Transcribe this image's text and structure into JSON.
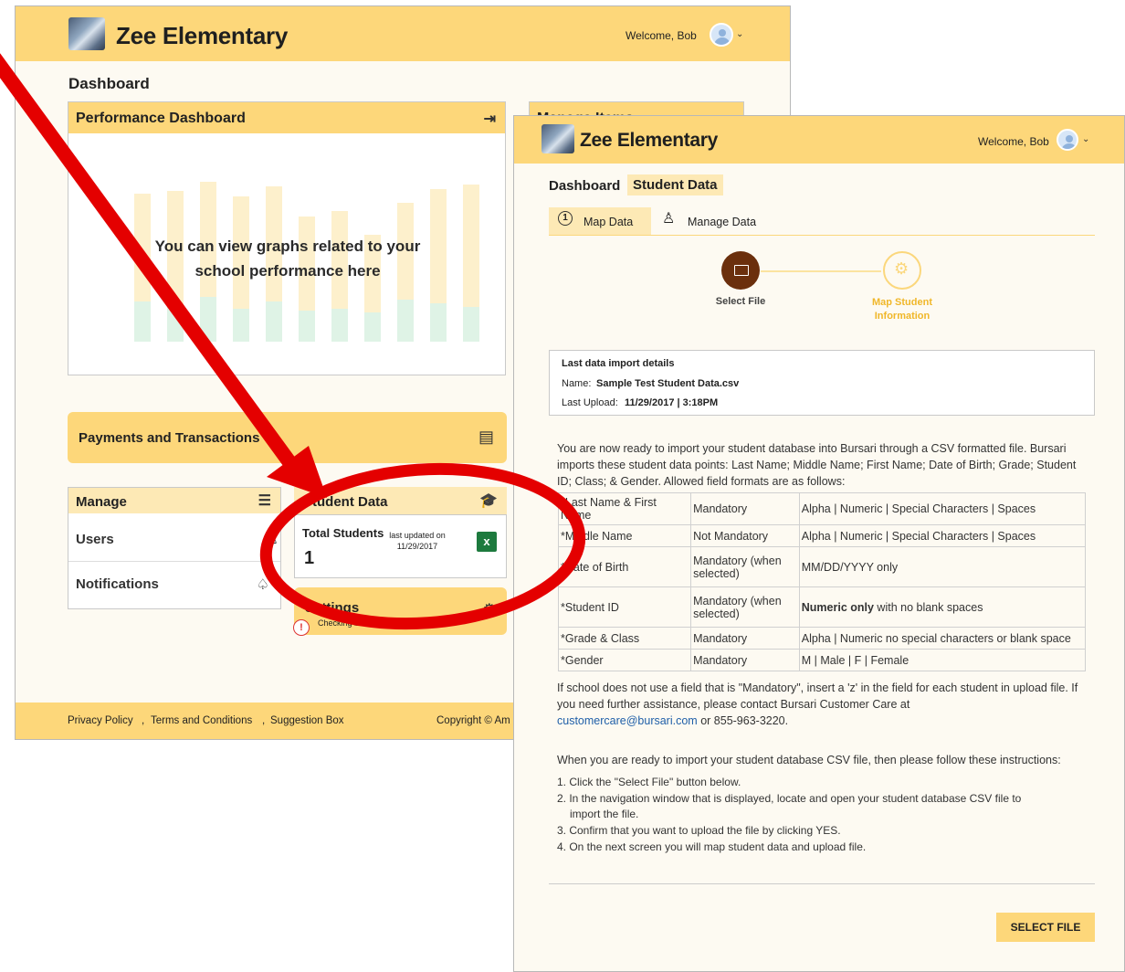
{
  "app": {
    "brand": "Zee Elementary",
    "welcome": "Welcome, Bob"
  },
  "dash": {
    "title": "Dashboard",
    "performance": {
      "title": "Performance Dashboard",
      "overlay": "You can view graphs related to your school performance here"
    },
    "manage_items_title": "Manage Items",
    "payments": "Payments and Transactions",
    "manage": {
      "title": "Manage",
      "items": [
        "Users",
        "Notifications"
      ]
    },
    "student_data": {
      "title": "Student Data",
      "total_label": "Total Students",
      "updated": "last updated on 11/29/2017",
      "count": "1"
    },
    "settings": {
      "title": "Settings",
      "status": "Checking bank"
    },
    "footer": {
      "privacy": "Privacy Policy",
      "terms": "Terms and Conditions",
      "suggestion": "Suggestion Box",
      "copyright": "Copyright © Am"
    }
  },
  "student_win": {
    "breadcrumb": {
      "dashboard": "Dashboard",
      "current": "Student Data"
    },
    "tabs": [
      "Map Data",
      "Manage Data"
    ],
    "steps": [
      "Select File",
      "Map Student Information"
    ],
    "last_import": {
      "heading": "Last data import details",
      "name_label": "Name:",
      "name_value": "Sample Test Student Data.csv",
      "upload_label": "Last Upload:",
      "upload_value": "11/29/2017 | 3:18PM"
    },
    "intro": "You are now ready to import your student database into Bursari through a CSV formatted file. Bursari imports these student data points: Last Name; Middle Name; First Name; Date of Birth; Grade; Student ID; Class; & Gender. Allowed field formats are as follows:",
    "table": [
      [
        "*Last Name & First Name",
        "Mandatory",
        "Alpha | Numeric | Special Characters | Spaces"
      ],
      [
        "*Middle Name",
        "Not Mandatory",
        "Alpha | Numeric | Special Characters | Spaces"
      ],
      [
        "*Date of Birth",
        "Mandatory (when selected)",
        "MM/DD/YYYY only"
      ],
      [
        "*Student ID",
        "Mandatory (when selected)",
        "with no blank spaces"
      ],
      [
        "*Grade & Class",
        "Mandatory",
        "Alpha | Numeric no special characters or blank space"
      ],
      [
        "*Gender",
        "Mandatory",
        "M | Male | F | Female"
      ]
    ],
    "table_bold": "Numeric only",
    "help_text": "If school does not use a field that is \"Mandatory\", insert a 'z' in the field for each student in upload file. If you need further assistance, please contact Bursari Customer Care at",
    "help_email": "customercare@bursari.com",
    "help_phone": "or 855-963-3220.",
    "instructions_intro": "When you are ready to import your student database CSV file, then please follow these instructions:",
    "instructions": [
      "1.  Click the \"Select File\" button below.",
      "2.  In the navigation window that is displayed, locate and open your student database CSV file to",
      "import the file.",
      "3.  Confirm that you want to upload the file by clicking YES.",
      "4.  On the next screen you will map student data and upload file."
    ],
    "select_button": "SELECT FILE"
  },
  "colors": {
    "header": "#fdd77a",
    "accent_brown": "#6b2f0d",
    "annotation_red": "#e40000",
    "link": "#1f5fa8"
  }
}
